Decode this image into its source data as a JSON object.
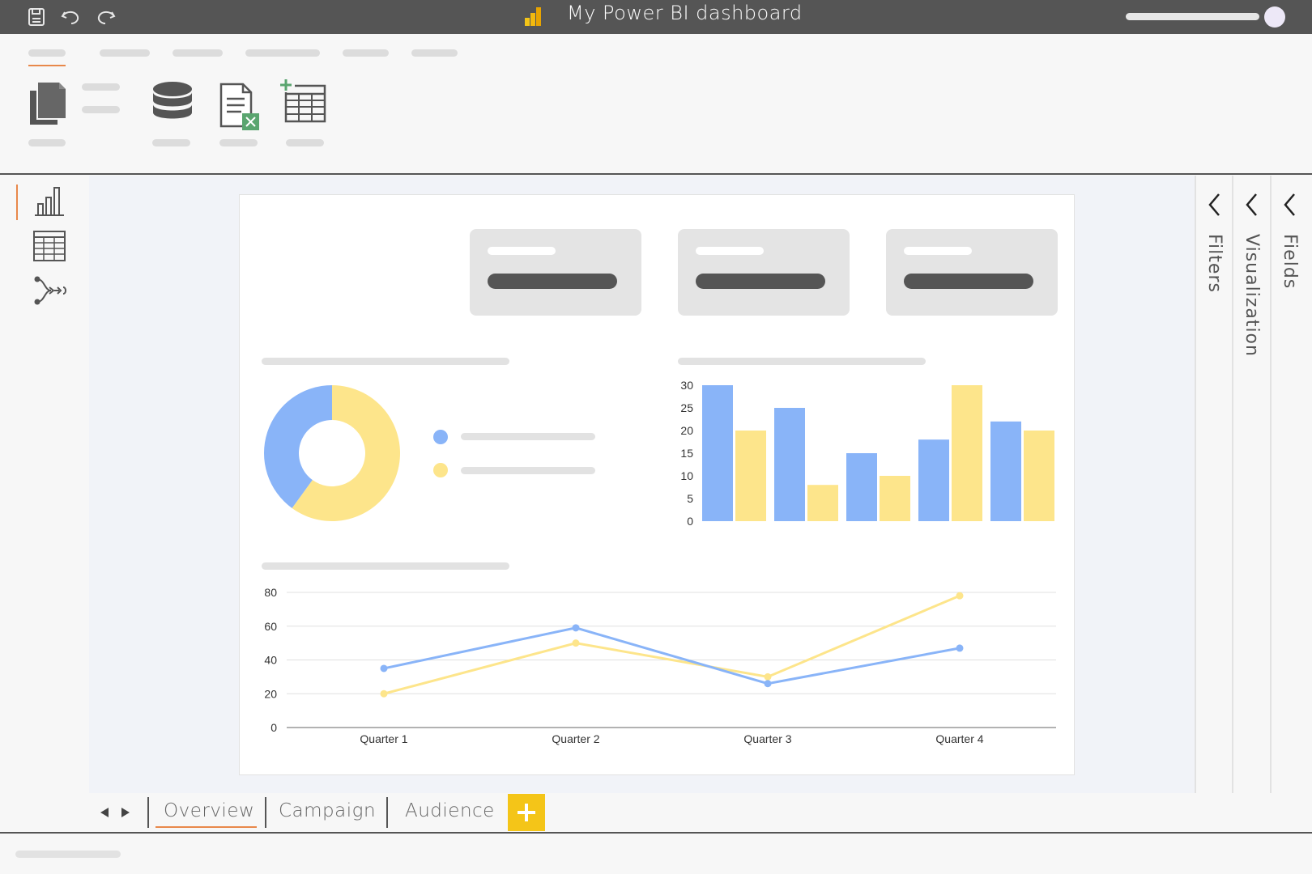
{
  "window": {
    "title": "My Power BI dashboard"
  },
  "colors": {
    "titlebar": "#555555",
    "accent": "#e8884a",
    "series_blue": "#89b4f8",
    "series_yellow": "#fde58b",
    "add_tab": "#f4c518",
    "excel_green": "#5aa56f"
  },
  "icons": {
    "save": "save-icon",
    "undo": "undo-icon",
    "redo": "redo-icon",
    "paste": "paste-icon",
    "database": "database-icon",
    "excel": "excel-icon",
    "new_table": "new-table-icon",
    "report_view": "bar-chart-icon",
    "data_view": "table-icon",
    "model_view": "model-icon"
  },
  "right_panes": {
    "filters": "Filters",
    "visualization": "Visualization",
    "fields": "Fields"
  },
  "tabs": [
    {
      "label": "Overview",
      "active": true
    },
    {
      "label": "Campaign",
      "active": false
    },
    {
      "label": "Audience",
      "active": false
    }
  ],
  "add_tab_label": "+",
  "chart_data": [
    {
      "type": "pie",
      "variant": "donut",
      "values": [
        40,
        60
      ],
      "colors": [
        "#89b4f8",
        "#fde58b"
      ]
    },
    {
      "type": "bar",
      "ylim": [
        0,
        30
      ],
      "yticks": [
        0,
        5,
        10,
        15,
        20,
        25,
        30
      ],
      "categories": [
        "",
        "",
        "",
        "",
        ""
      ],
      "series": [
        {
          "values": [
            30,
            25,
            15,
            18,
            22
          ],
          "color": "#89b4f8"
        },
        {
          "values": [
            20,
            8,
            10,
            30,
            20
          ],
          "color": "#fde58b"
        }
      ]
    },
    {
      "type": "line",
      "categories": [
        "Quarter 1",
        "Quarter 2",
        "Quarter 3",
        "Quarter 4"
      ],
      "ylim": [
        0,
        80
      ],
      "yticks": [
        0,
        20,
        40,
        60,
        80
      ],
      "grid": true,
      "series": [
        {
          "values": [
            35,
            59,
            26,
            47
          ],
          "color": "#89b4f8"
        },
        {
          "values": [
            20,
            50,
            30,
            78
          ],
          "color": "#fde58b"
        }
      ]
    }
  ]
}
